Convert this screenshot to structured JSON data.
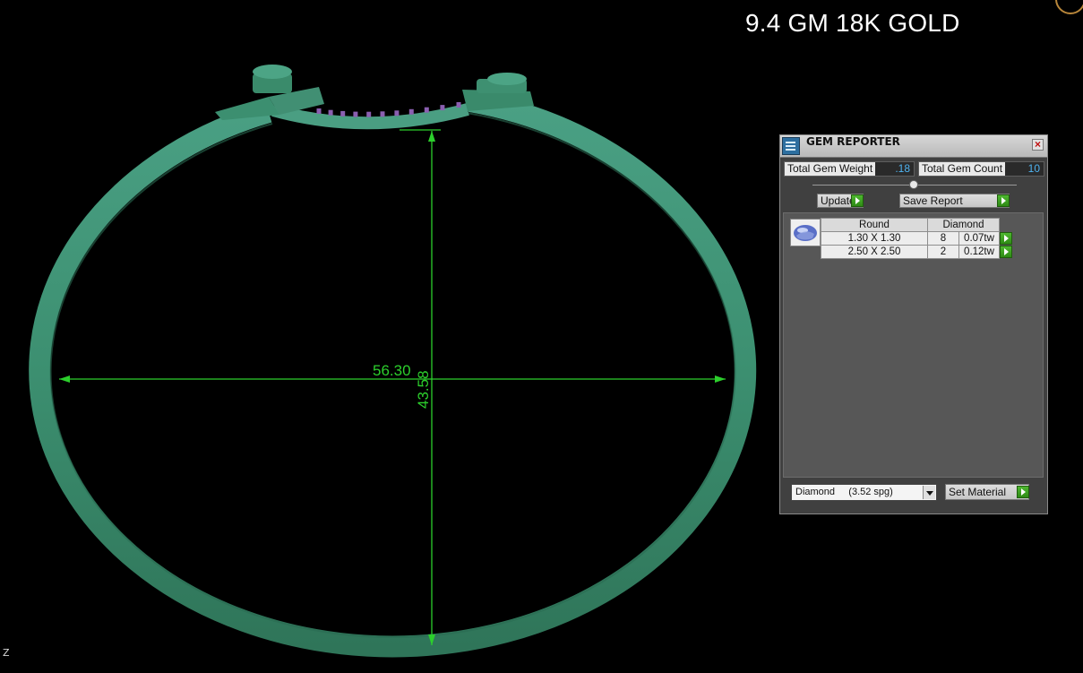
{
  "viewport": {
    "title_text": "9.4 GM 18K GOLD",
    "axis_label": "Z",
    "dimensions": {
      "width_value": "56.30",
      "height_value": "43.58"
    },
    "colors": {
      "background": "#000000",
      "model": "#3c8f70",
      "dimension_line": "#2ccf2c",
      "gems": "#8a5fb0"
    }
  },
  "gem_reporter": {
    "title": "GEM REPORTER",
    "close_icon": "close-icon",
    "total_weight_label": "Total Gem Weight",
    "total_weight_value": ".18",
    "total_count_label": "Total Gem Count",
    "total_count_value": "10",
    "update_label": "Update",
    "save_report_label": "Save Report",
    "table": {
      "shape_header": "Round",
      "material_header": "Diamond",
      "rows": [
        {
          "size": "1.30 X 1.30",
          "count": "8",
          "weight": "0.07tw"
        },
        {
          "size": "2.50 X 2.50",
          "count": "2",
          "weight": "0.12tw"
        }
      ]
    },
    "material_select_value": "Diamond     (3.52 spg)",
    "set_material_label": "Set Material",
    "colors": {
      "panel": "#404040",
      "value_text": "#4fb3f0",
      "go_button": "#3a9e22"
    }
  }
}
